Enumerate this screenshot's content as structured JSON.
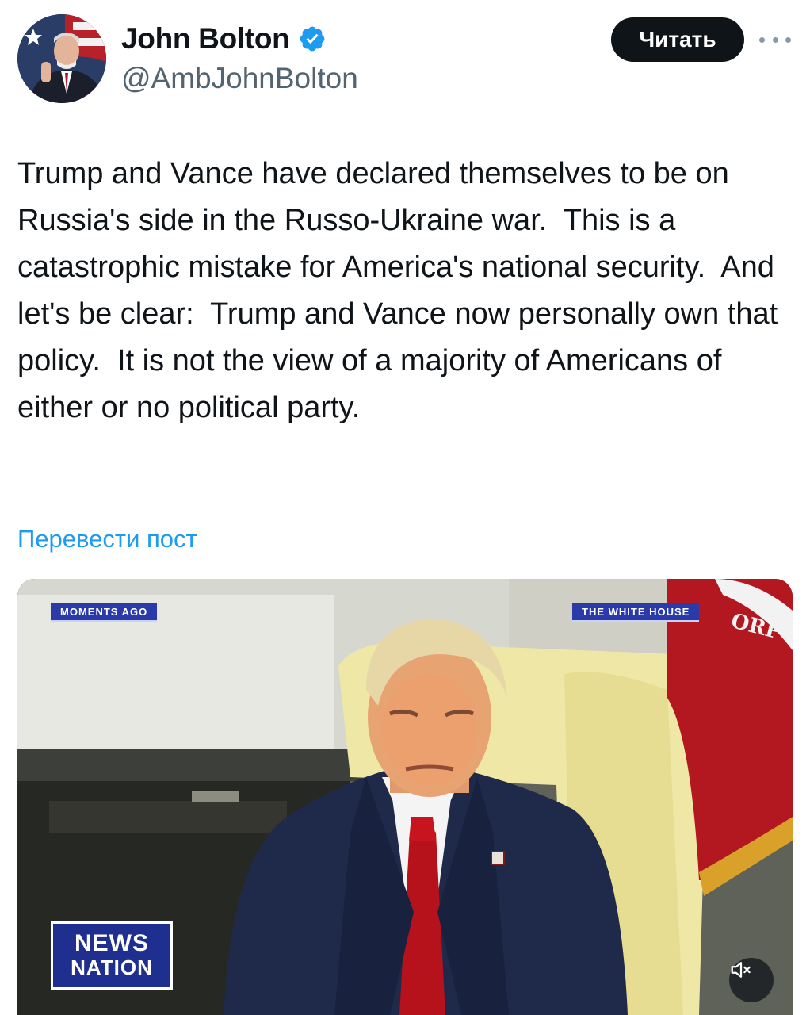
{
  "author": {
    "name": "John Bolton",
    "handle": "@AmbJohnBolton",
    "verified": true
  },
  "actions": {
    "follow_label": "Читать",
    "more_icon": "more-horizontal-icon"
  },
  "tweet": {
    "text": "Trump and Vance have declared themselves to be on Russia's side in the Russo-Ukraine war.  This is a catastrophic mistake for America's national security.  And let's be clear:  Trump and Vance now personally own that policy.  It is not the view of a majority of Americans of either or no political party.",
    "translate_label": "Перевести пост"
  },
  "media": {
    "chyron_left": "MOMENTS AGO",
    "chyron_right": "THE WHITE HOUSE",
    "flag_text": "ORP",
    "logo_line1": "NEWS",
    "logo_line2": "NATION",
    "mute_icon": "volume-muted-icon"
  },
  "colors": {
    "link": "#1d9bf0",
    "verified": "#1d9bf0",
    "follow_bg": "#0f1419",
    "chyron_bg": "#2a3aa8"
  }
}
